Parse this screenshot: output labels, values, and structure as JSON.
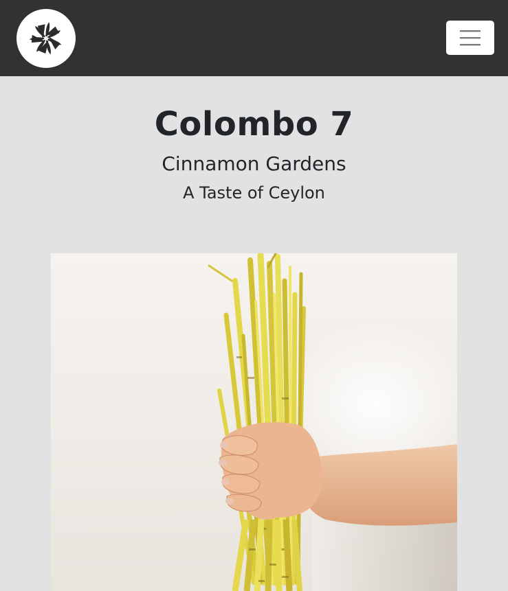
{
  "header": {
    "logo_icon": "pinwheel-flower-icon",
    "menu_icon": "hamburger-menu-icon",
    "background_color": "#313333"
  },
  "hero": {
    "title": "Colombo 7",
    "subtitle": "Cinnamon Gardens",
    "tagline": "A Taste of Ceylon"
  },
  "photo": {
    "subject": "lemongrass-bundle-image"
  },
  "colors": {
    "page_background": "#e2e2e2",
    "text": "#212529"
  }
}
